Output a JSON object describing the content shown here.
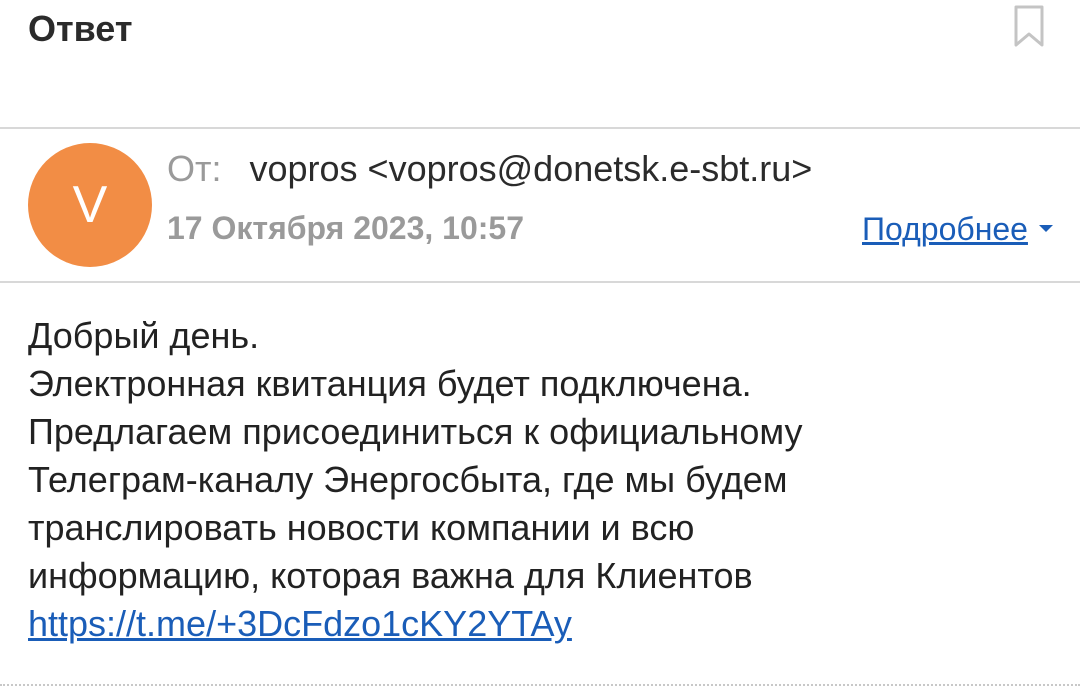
{
  "header": {
    "subject": "Ответ"
  },
  "sender": {
    "avatar_letter": "V",
    "avatar_color": "#f28d45",
    "from_label": "От:",
    "from_value": "vopros <vopros@donetsk.e-sbt.ru>",
    "date": "17 Октября 2023, 10:57",
    "details_label": "Подробнее"
  },
  "message": {
    "lines": [
      "Добрый день.",
      "Электронная квитанция будет подключена.",
      "Предлагаем присоединиться к официальному",
      "Телеграм-каналу Энергосбыта, где мы будем",
      "транслировать новости компании и всю",
      "информацию, которая важна для Клиентов"
    ],
    "link": "https://t.me/+3DcFdzo1cKY2YTAy"
  },
  "colors": {
    "link": "#1a5db8",
    "muted": "#9a9a9a",
    "divider": "#d8d8d8"
  },
  "icons": {
    "bookmark": "bookmark-icon",
    "details_caret": "caret-down-icon"
  }
}
